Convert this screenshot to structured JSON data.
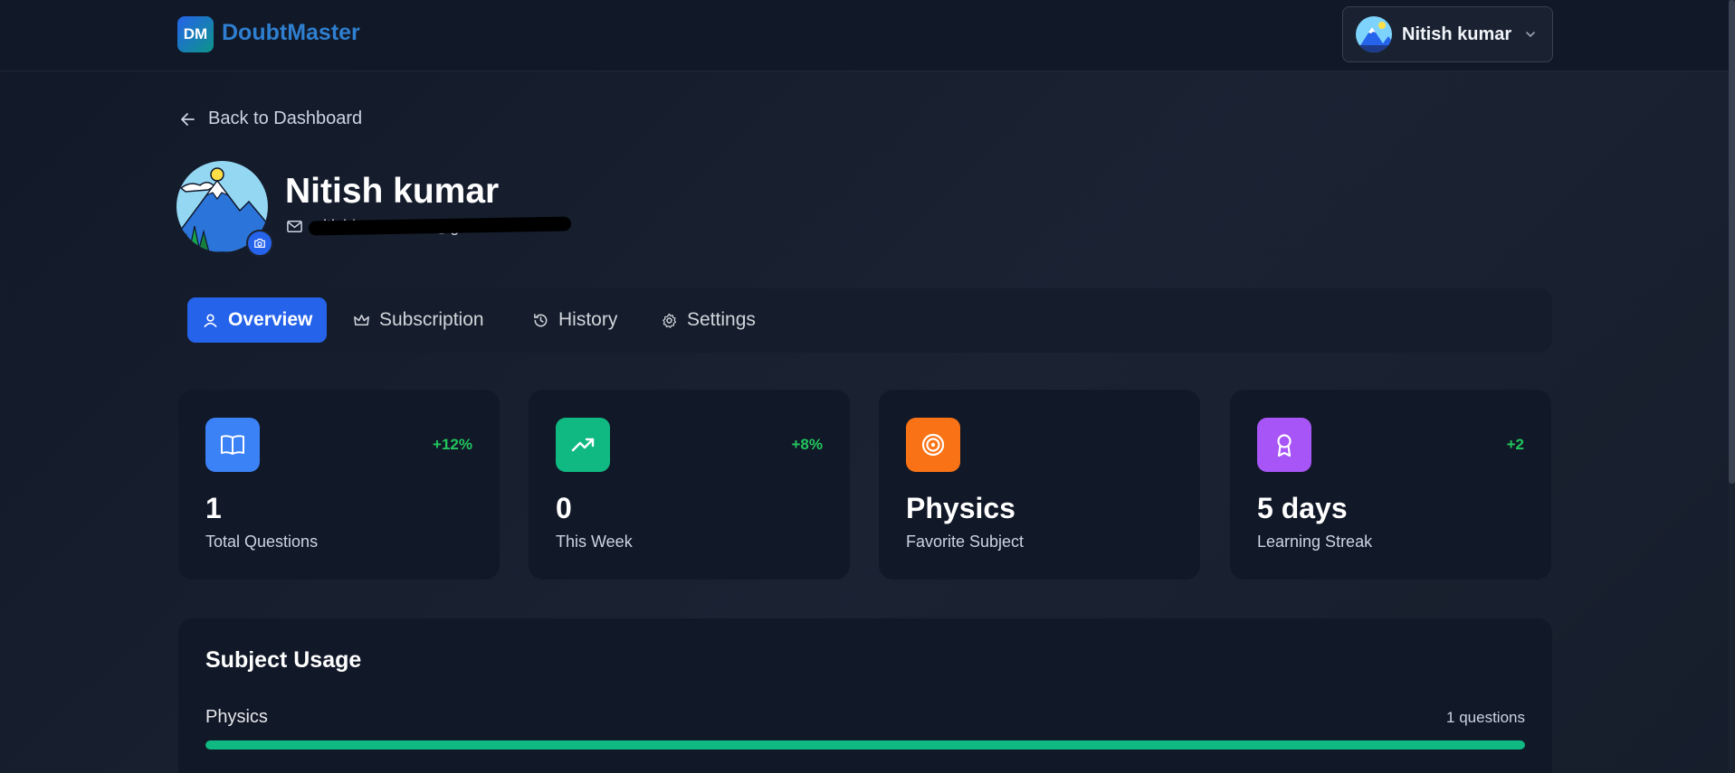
{
  "header": {
    "logo_badge": "DM",
    "app_name": "DoubtMaster",
    "user_name": "Nitish kumar"
  },
  "nav": {
    "back_label": "Back to Dashboard"
  },
  "profile": {
    "name": "Nitish kumar",
    "email": "nitishkumar7890@gmail.com"
  },
  "tabs": [
    {
      "label": "Overview",
      "icon": "user-icon",
      "active": true
    },
    {
      "label": "Subscription",
      "icon": "crown-icon",
      "active": false
    },
    {
      "label": "History",
      "icon": "history-icon",
      "active": false
    },
    {
      "label": "Settings",
      "icon": "gear-icon",
      "active": false
    }
  ],
  "stats": [
    {
      "value": "1",
      "label": "Total Questions",
      "delta": "+12%",
      "icon": "book-open-icon",
      "color": "#3b82f6"
    },
    {
      "value": "0",
      "label": "This Week",
      "delta": "+8%",
      "icon": "trending-up-icon",
      "color": "#10b981"
    },
    {
      "value": "Physics",
      "label": "Favorite Subject",
      "delta": "",
      "icon": "target-icon",
      "color": "#f97316"
    },
    {
      "value": "5 days",
      "label": "Learning Streak",
      "delta": "+2",
      "icon": "award-icon",
      "color": "#a855f7"
    }
  ],
  "usage": {
    "title": "Subject Usage",
    "subjects": [
      {
        "name": "Physics",
        "count_label": "1 questions",
        "share": 1.0
      }
    ]
  },
  "colors": {
    "accent": "#2563eb",
    "success": "#22c55e",
    "bar": "#10b981"
  }
}
